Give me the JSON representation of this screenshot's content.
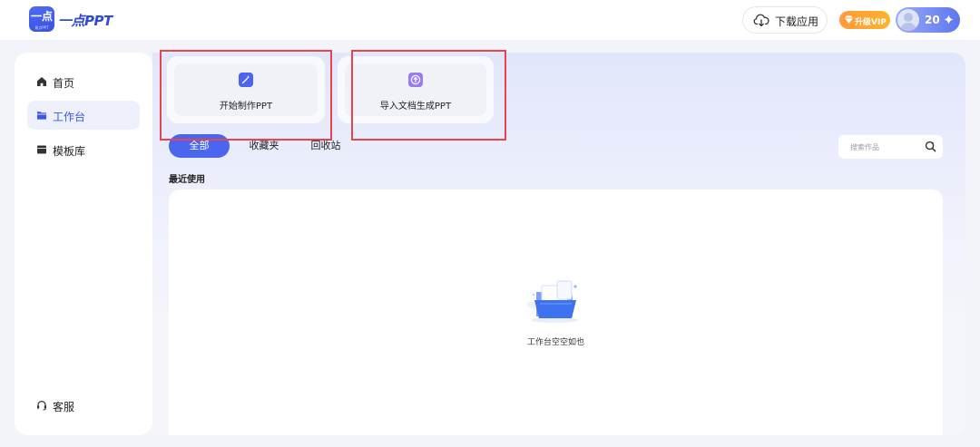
{
  "brand": {
    "logo_mark": "一点",
    "logo_sub": "易点PPT",
    "name": "一点PPT",
    "accent": "#3b55e6"
  },
  "header": {
    "download": {
      "label": "下载应用",
      "icon": "cloud-download-icon"
    },
    "vip": {
      "label": "升级VIP",
      "icon": "diamond-icon",
      "color": "#ff9a3c"
    },
    "user": {
      "points": "20",
      "icon": "sparkle-icon"
    }
  },
  "sidebar": {
    "items": [
      {
        "label": "首页",
        "icon": "home-icon",
        "active": false
      },
      {
        "label": "工作台",
        "icon": "folder-icon",
        "active": true
      },
      {
        "label": "模板库",
        "icon": "template-icon",
        "active": false
      }
    ],
    "service": {
      "label": "客服",
      "icon": "headset-icon"
    }
  },
  "actions": {
    "start": {
      "label": "开始制作PPT",
      "icon": "magic-wand-icon"
    },
    "import": {
      "label": "导入文档生成PPT",
      "icon": "upload-icon"
    }
  },
  "tabs": [
    {
      "label": "全部",
      "active": true
    },
    {
      "label": "收藏夹",
      "active": false
    },
    {
      "label": "回收站",
      "active": false
    }
  ],
  "search": {
    "placeholder": "搜索作品",
    "icon": "search-icon"
  },
  "recent": {
    "title": "最近使用",
    "empty_text": "工作台空空如也",
    "empty_icon": "empty-folder-icon"
  }
}
